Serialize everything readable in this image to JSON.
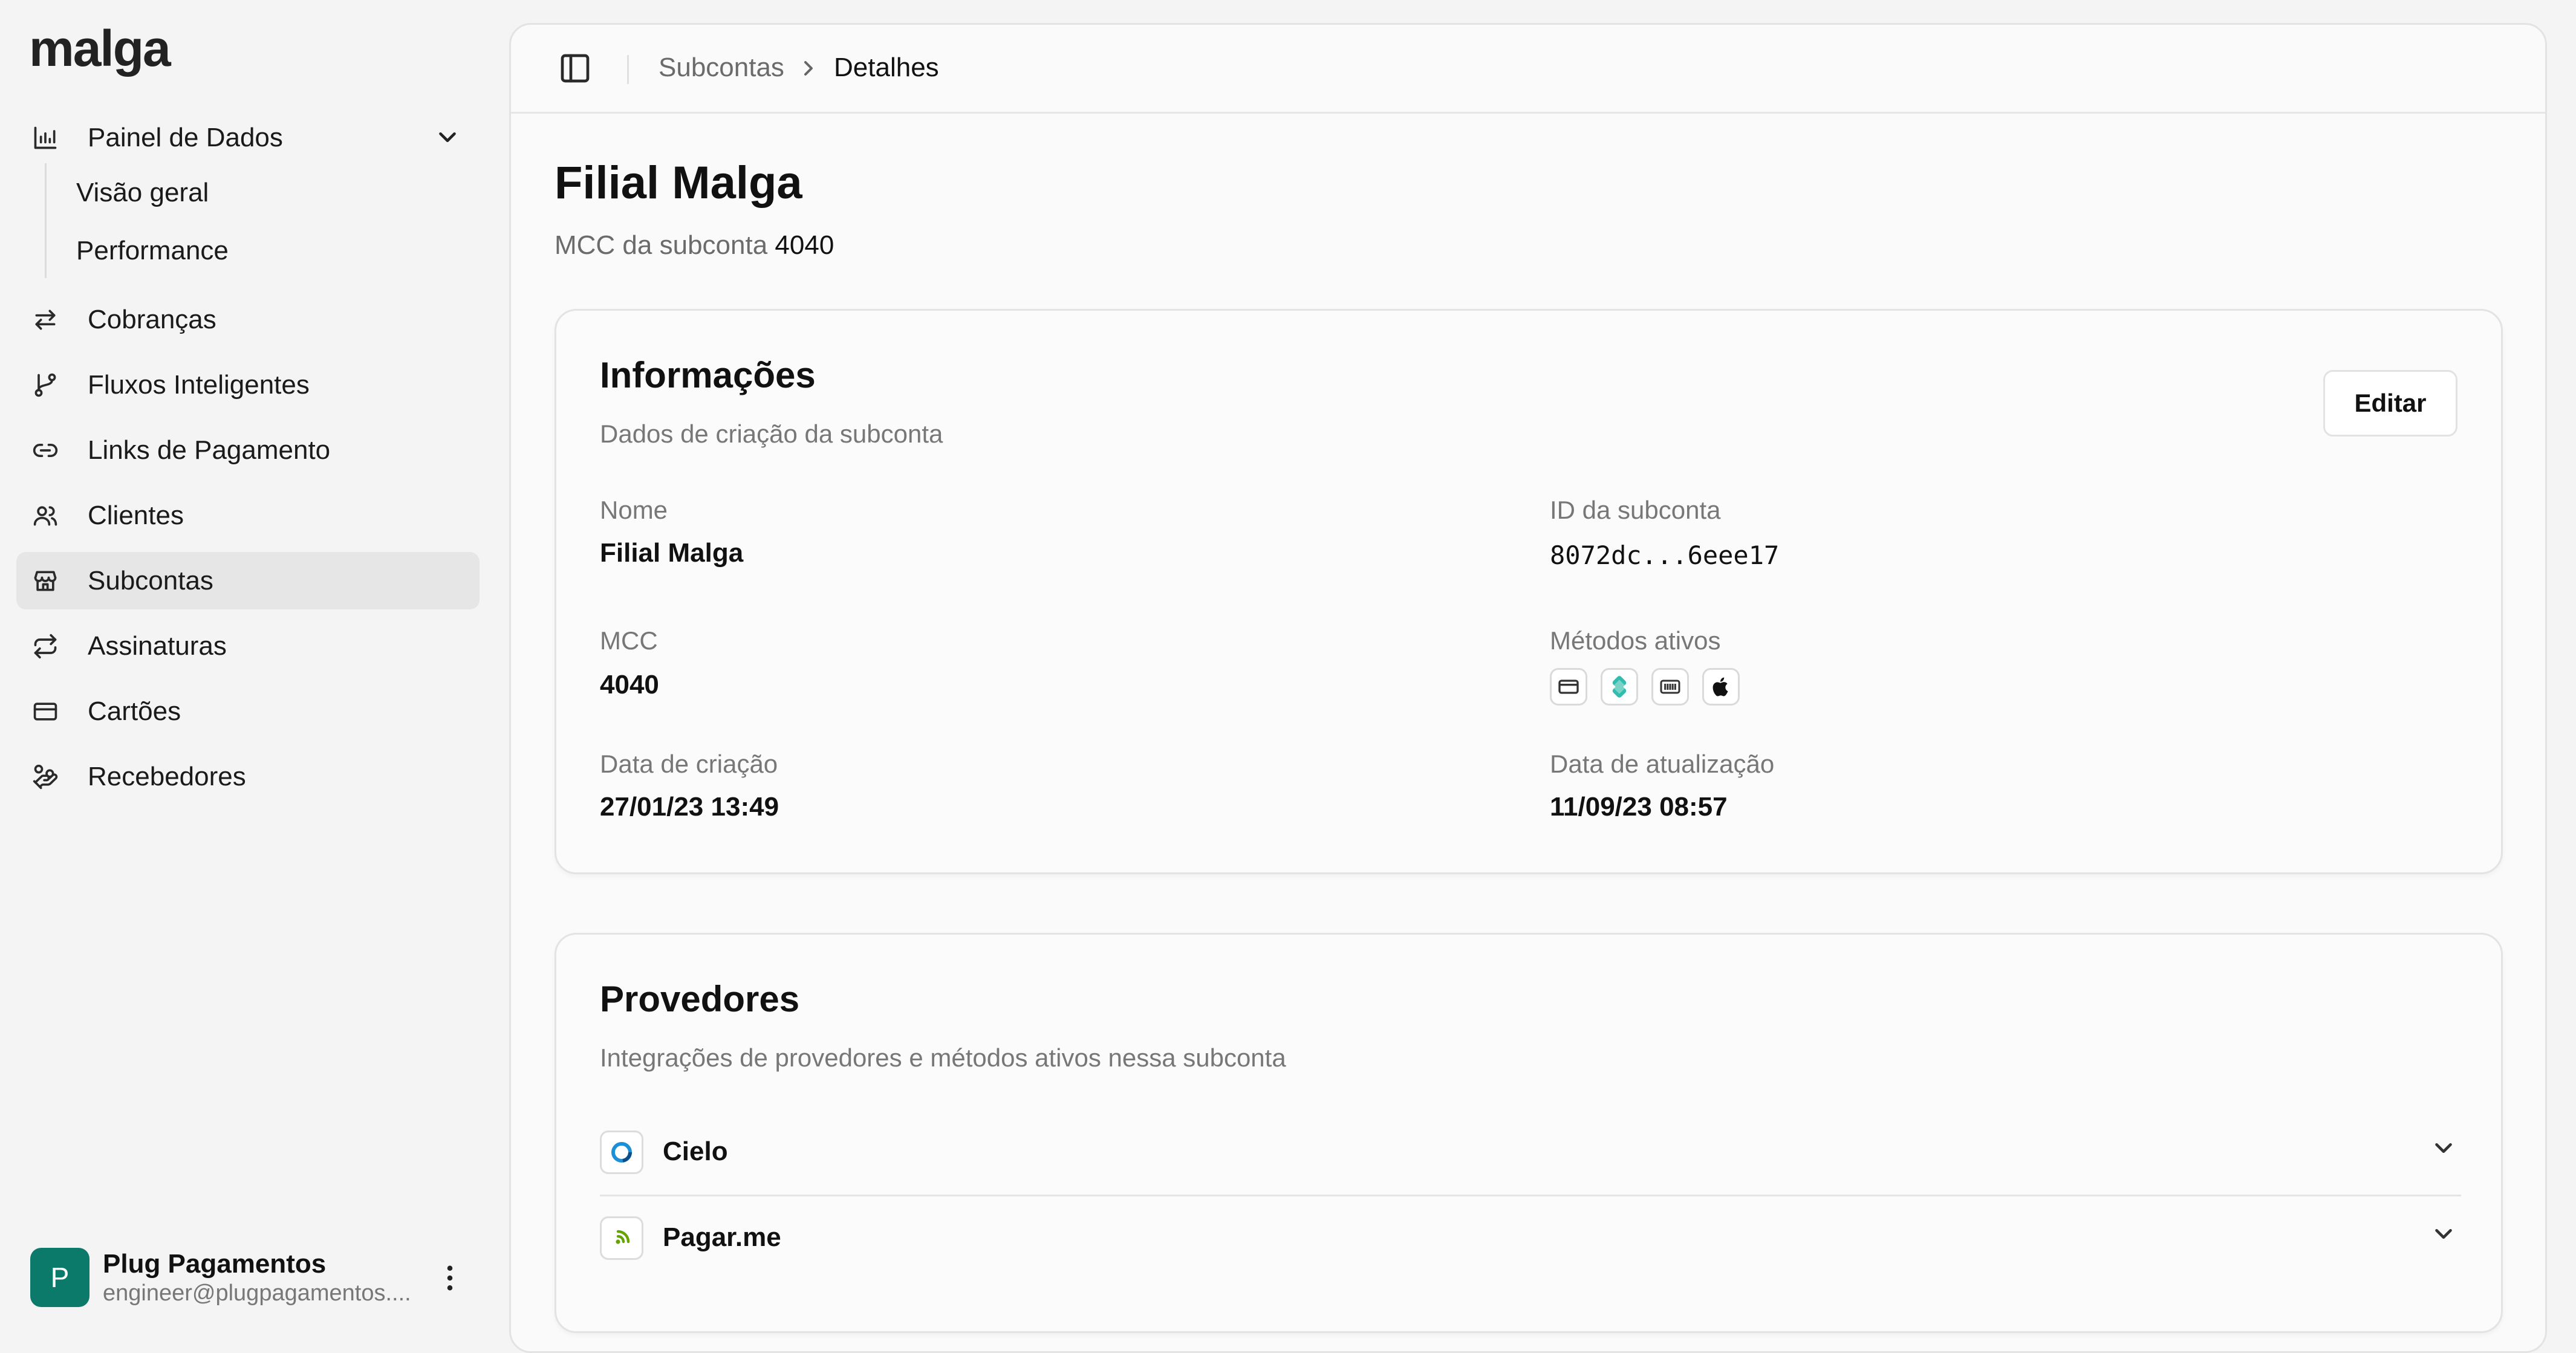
{
  "app": {
    "logo": "malga"
  },
  "sidebar": {
    "items": [
      {
        "label": "Painel de Dados",
        "icon": "bar-chart-icon"
      },
      {
        "label": "Cobranças",
        "icon": "arrows-exchange-icon"
      },
      {
        "label": "Fluxos Inteligentes",
        "icon": "git-branch-icon"
      },
      {
        "label": "Links de Pagamento",
        "icon": "link-icon"
      },
      {
        "label": "Clientes",
        "icon": "users-icon"
      },
      {
        "label": "Subcontas",
        "icon": "store-icon",
        "active": true
      },
      {
        "label": "Assinaturas",
        "icon": "repeat-icon"
      },
      {
        "label": "Cartões",
        "icon": "credit-card-icon"
      },
      {
        "label": "Recebedores",
        "icon": "hand-coins-icon"
      }
    ],
    "subitems": [
      "Visão geral",
      "Performance"
    ]
  },
  "user": {
    "initial": "P",
    "name": "Plug Pagamentos",
    "email": "engineer@plugpagamentos...."
  },
  "header": {
    "breadcrumb": [
      "Subcontas",
      "Detalhes"
    ]
  },
  "page": {
    "title": "Filial Malga",
    "subtitle_label": "MCC da subconta",
    "subtitle_value": "4040"
  },
  "info_card": {
    "title": "Informações",
    "description": "Dados de criação da subconta",
    "edit_label": "Editar",
    "fields": {
      "name_label": "Nome",
      "name_value": "Filial Malga",
      "id_label": "ID da subconta",
      "id_value": "8072dc...6eee17",
      "mcc_label": "MCC",
      "mcc_value": "4040",
      "methods_label": "Métodos ativos",
      "created_label": "Data de criação",
      "created_value": "27/01/23 13:49",
      "updated_label": "Data de atualização",
      "updated_value": "11/09/23 08:57"
    },
    "methods": [
      "credit-card-icon",
      "pix-icon",
      "boleto-icon",
      "apple-pay-icon"
    ]
  },
  "providers_card": {
    "title": "Provedores",
    "description": "Integrações de provedores e métodos ativos nessa subconta",
    "providers": [
      {
        "name": "Cielo",
        "icon": "cielo-logo-icon"
      },
      {
        "name": "Pagar.me",
        "icon": "pagarme-logo-icon"
      }
    ]
  },
  "colors": {
    "background": "#f4f4f4",
    "panel": "#fafafa",
    "active_nav": "#e6e6e6",
    "avatar": "#0c7a6a",
    "pix": "#32bcad"
  }
}
